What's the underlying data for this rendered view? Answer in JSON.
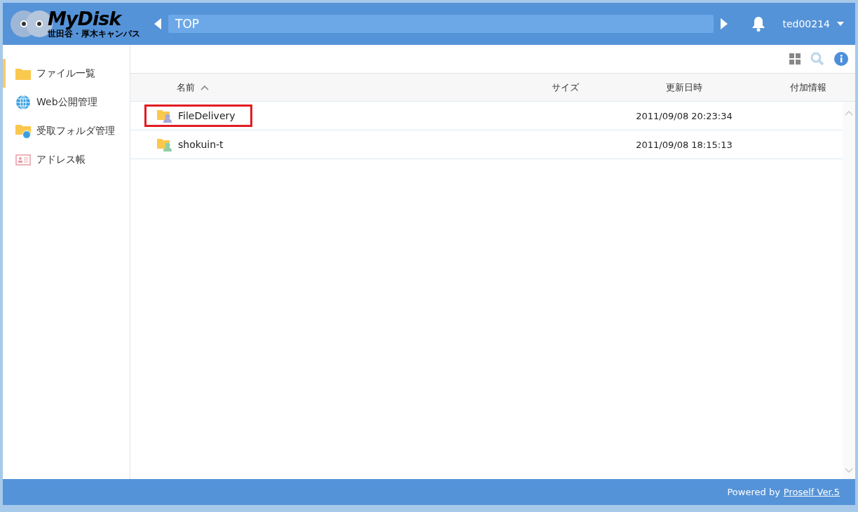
{
  "header": {
    "logo_title": "MyDisk",
    "logo_subtitle": "世田谷・厚木キャンパス",
    "path": "TOP",
    "user": "ted00214"
  },
  "sidebar": {
    "items": [
      {
        "label": "ファイル一覧",
        "kind": "folder",
        "selected": true
      },
      {
        "label": "Web公開管理",
        "kind": "globe",
        "selected": false
      },
      {
        "label": "受取フォルダ管理",
        "kind": "folder-globe",
        "selected": false
      },
      {
        "label": "アドレス帳",
        "kind": "address",
        "selected": false
      }
    ]
  },
  "table": {
    "columns": [
      {
        "label": "名前",
        "sorted_ascending": true
      },
      {
        "label": "サイズ"
      },
      {
        "label": "更新日時"
      },
      {
        "label": "付加情報"
      }
    ],
    "rows": [
      {
        "name": "FileDelivery",
        "date": "2011/09/08 20:23:34",
        "color": "#a9a9d8",
        "highlighted": true
      },
      {
        "name": "shokuin-t",
        "date": "2011/09/08 18:15:13",
        "color": "#8fcfa6",
        "highlighted": false
      }
    ]
  },
  "footer": {
    "text": "Powered by",
    "link": "Proself Ver.5"
  }
}
